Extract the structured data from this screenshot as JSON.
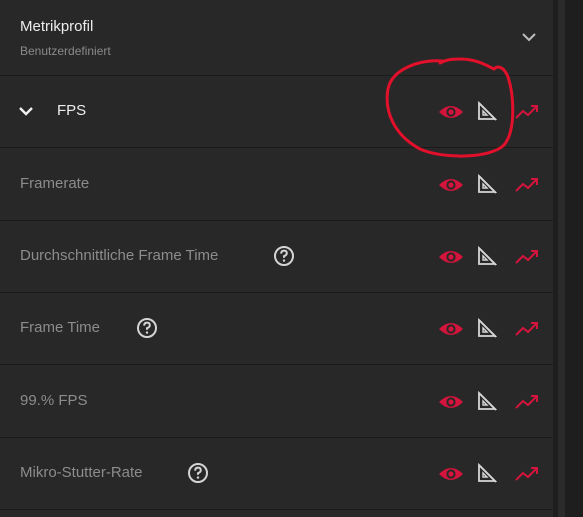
{
  "profile": {
    "title": "Metrikprofil",
    "subtitle": "Benutzerdefiniert"
  },
  "section": {
    "label": "FPS",
    "expanded": true
  },
  "metrics": [
    {
      "label": "Framerate",
      "has_help": false
    },
    {
      "label": "Durchschnittliche Frame Time",
      "has_help": true
    },
    {
      "label": "Frame Time",
      "has_help": true
    },
    {
      "label": "99.% FPS",
      "has_help": false
    },
    {
      "label": "Mikro-Stutter-Rate",
      "has_help": true
    }
  ],
  "icons": {
    "visibility": "eye-icon",
    "threshold": "ruler-icon",
    "graph": "trend-icon",
    "help": "help-icon",
    "expand": "chevron-down-icon"
  },
  "colors": {
    "accent": "#d3143c",
    "panel": "#282828",
    "text": "#ececec",
    "muted_text": "#8c8c8c",
    "annotation": "#e3102b"
  }
}
